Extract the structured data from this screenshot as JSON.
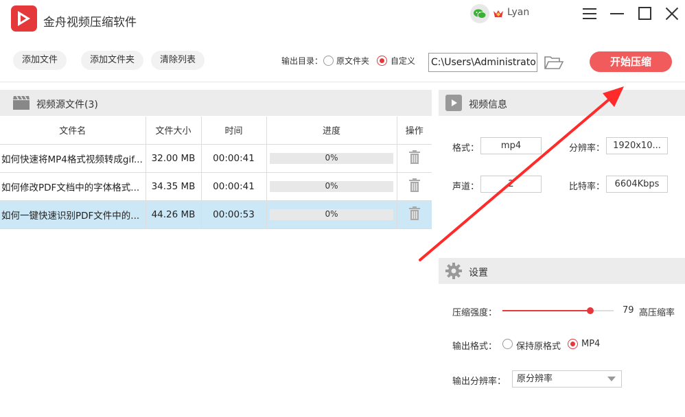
{
  "app": {
    "title": "金舟视频压缩软件",
    "user": "Lyan"
  },
  "toolbar": {
    "add_file": "添加文件",
    "add_folder": "添加文件夹",
    "clear_list": "清除列表",
    "output_dir_label": "输出目录：",
    "option_source": "原文件夹",
    "option_custom": "自定义",
    "output_path": "C:\\Users\\Administrator\\",
    "start": "开始压缩"
  },
  "source": {
    "title": "视频源文件(3)",
    "columns": [
      "文件名",
      "文件大小",
      "时间",
      "进度",
      "操作"
    ],
    "rows": [
      {
        "name": "如何快速将MP4格式视频转成gif...",
        "size": "32.00 MB",
        "time": "00:00:41",
        "progress": "0%"
      },
      {
        "name": "如何修改PDF文档中的字体格式...",
        "size": "34.35 MB",
        "time": "00:00:41",
        "progress": "0%"
      },
      {
        "name": "如何一键快速识别PDF文件中的...",
        "size": "44.26 MB",
        "time": "00:00:53",
        "progress": "0%"
      }
    ],
    "selected_row": 2
  },
  "info": {
    "title": "视频信息",
    "format_label": "格式：",
    "format": "mp4",
    "resolution_label": "分辨率：",
    "resolution": "1920x10...",
    "channel_label": "声道：",
    "channel": "2",
    "bitrate_label": "比特率：",
    "bitrate": "6604Kbps"
  },
  "settings": {
    "title": "设置",
    "strength_label": "压缩强度：",
    "strength_value": "79",
    "strength_fraction": 0.79,
    "strength_desc": "高压缩率",
    "format_label": "输出格式：",
    "format_keep": "保持原格式",
    "format_mp4": "MP4",
    "resolution_label": "输出分辨率：",
    "resolution_value": "原分辨率"
  },
  "colors": {
    "accent": "#e5383b",
    "start_button": "#f15b5b",
    "selected_row": "#cce8f7",
    "arrow": "#ff2a2a"
  }
}
